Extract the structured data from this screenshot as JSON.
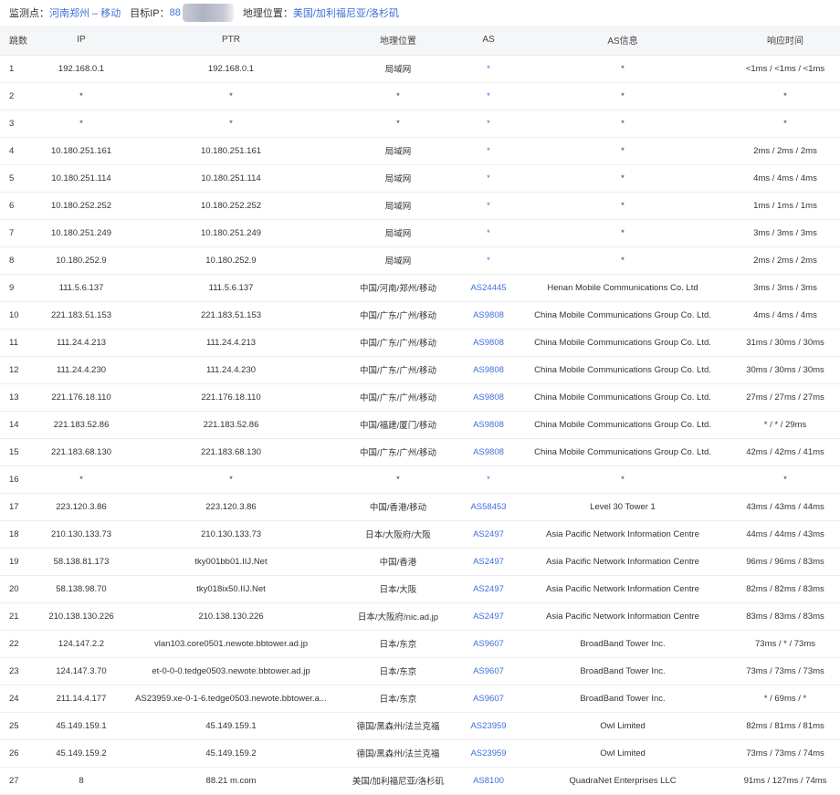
{
  "header": {
    "probe_label": "监测点：",
    "probe_value": "河南郑州 – 移动",
    "target_label": "目标IP：",
    "target_value": "88",
    "geo_label": "地理位置：",
    "geo_value": "美国/加利福尼亚/洛杉矶"
  },
  "table": {
    "columns": [
      "跳数",
      "IP",
      "PTR",
      "地理位置",
      "AS",
      "AS信息",
      "响应时间"
    ],
    "rows": [
      {
        "hop": "1",
        "ip": "192.168.0.1",
        "ptr": "192.168.0.1",
        "geo": "局域网",
        "as": "*",
        "asinfo": "*",
        "rtt": "<1ms / <1ms / <1ms"
      },
      {
        "hop": "2",
        "ip": "*",
        "ptr": "*",
        "geo": "*",
        "as": "*",
        "asinfo": "*",
        "rtt": "*"
      },
      {
        "hop": "3",
        "ip": "*",
        "ptr": "*",
        "geo": "*",
        "as": "*",
        "asinfo": "*",
        "rtt": "*"
      },
      {
        "hop": "4",
        "ip": "10.180.251.161",
        "ptr": "10.180.251.161",
        "geo": "局域网",
        "as": "*",
        "asinfo": "*",
        "rtt": "2ms / 2ms / 2ms"
      },
      {
        "hop": "5",
        "ip": "10.180.251.114",
        "ptr": "10.180.251.114",
        "geo": "局域网",
        "as": "*",
        "asinfo": "*",
        "rtt": "4ms / 4ms / 4ms"
      },
      {
        "hop": "6",
        "ip": "10.180.252.252",
        "ptr": "10.180.252.252",
        "geo": "局域网",
        "as": "*",
        "asinfo": "*",
        "rtt": "1ms / 1ms / 1ms"
      },
      {
        "hop": "7",
        "ip": "10.180.251.249",
        "ptr": "10.180.251.249",
        "geo": "局域网",
        "as": "*",
        "asinfo": "*",
        "rtt": "3ms / 3ms / 3ms"
      },
      {
        "hop": "8",
        "ip": "10.180.252.9",
        "ptr": "10.180.252.9",
        "geo": "局域网",
        "as": "*",
        "asinfo": "*",
        "rtt": "2ms / 2ms / 2ms"
      },
      {
        "hop": "9",
        "ip": "111.5.6.137",
        "ptr": "111.5.6.137",
        "geo": "中国/河南/郑州/移动",
        "as": "AS24445",
        "asinfo": "Henan Mobile Communications Co. Ltd",
        "rtt": "3ms / 3ms / 3ms"
      },
      {
        "hop": "10",
        "ip": "221.183.51.153",
        "ptr": "221.183.51.153",
        "geo": "中国/广东/广州/移动",
        "as": "AS9808",
        "asinfo": "China Mobile Communications Group Co. Ltd.",
        "rtt": "4ms / 4ms / 4ms"
      },
      {
        "hop": "11",
        "ip": "111.24.4.213",
        "ptr": "111.24.4.213",
        "geo": "中国/广东/广州/移动",
        "as": "AS9808",
        "asinfo": "China Mobile Communications Group Co. Ltd.",
        "rtt": "31ms / 30ms / 30ms"
      },
      {
        "hop": "12",
        "ip": "111.24.4.230",
        "ptr": "111.24.4.230",
        "geo": "中国/广东/广州/移动",
        "as": "AS9808",
        "asinfo": "China Mobile Communications Group Co. Ltd.",
        "rtt": "30ms / 30ms / 30ms"
      },
      {
        "hop": "13",
        "ip": "221.176.18.110",
        "ptr": "221.176.18.110",
        "geo": "中国/广东/广州/移动",
        "as": "AS9808",
        "asinfo": "China Mobile Communications Group Co. Ltd.",
        "rtt": "27ms / 27ms / 27ms"
      },
      {
        "hop": "14",
        "ip": "221.183.52.86",
        "ptr": "221.183.52.86",
        "geo": "中国/福建/厦门/移动",
        "as": "AS9808",
        "asinfo": "China Mobile Communications Group Co. Ltd.",
        "rtt": "* / * / 29ms"
      },
      {
        "hop": "15",
        "ip": "221.183.68.130",
        "ptr": "221.183.68.130",
        "geo": "中国/广东/广州/移动",
        "as": "AS9808",
        "asinfo": "China Mobile Communications Group Co. Ltd.",
        "rtt": "42ms / 42ms / 41ms"
      },
      {
        "hop": "16",
        "ip": "*",
        "ptr": "*",
        "geo": "*",
        "as": "*",
        "asinfo": "*",
        "rtt": "*"
      },
      {
        "hop": "17",
        "ip": "223.120.3.86",
        "ptr": "223.120.3.86",
        "geo": "中国/香港/移动",
        "as": "AS58453",
        "asinfo": "Level 30 Tower 1",
        "rtt": "43ms / 43ms / 44ms"
      },
      {
        "hop": "18",
        "ip": "210.130.133.73",
        "ptr": "210.130.133.73",
        "geo": "日本/大阪府/大阪",
        "as": "AS2497",
        "asinfo": "Asia Pacific Network Information Centre",
        "rtt": "44ms / 44ms / 43ms"
      },
      {
        "hop": "19",
        "ip": "58.138.81.173",
        "ptr": "tky001bb01.IIJ.Net",
        "geo": "中国/香港",
        "as": "AS2497",
        "asinfo": "Asia Pacific Network Information Centre",
        "rtt": "96ms / 96ms / 83ms"
      },
      {
        "hop": "20",
        "ip": "58.138.98.70",
        "ptr": "tky018ix50.IIJ.Net",
        "geo": "日本/大阪",
        "as": "AS2497",
        "asinfo": "Asia Pacific Network Information Centre",
        "rtt": "82ms / 82ms / 83ms"
      },
      {
        "hop": "21",
        "ip": "210.138.130.226",
        "ptr": "210.138.130.226",
        "geo": "日本/大阪府/nic.ad.jp",
        "as": "AS2497",
        "asinfo": "Asia Pacific Network Information Centre",
        "rtt": "83ms / 83ms / 83ms"
      },
      {
        "hop": "22",
        "ip": "124.147.2.2",
        "ptr": "vlan103.core0501.newote.bbtower.ad.jp",
        "geo": "日本/东京",
        "as": "AS9607",
        "asinfo": "BroadBand Tower Inc.",
        "rtt": "73ms / * / 73ms"
      },
      {
        "hop": "23",
        "ip": "124.147.3.70",
        "ptr": "et-0-0-0.tedge0503.newote.bbtower.ad.jp",
        "geo": "日本/东京",
        "as": "AS9607",
        "asinfo": "BroadBand Tower Inc.",
        "rtt": "73ms / 73ms / 73ms"
      },
      {
        "hop": "24",
        "ip": "211.14.4.177",
        "ptr": "AS23959.xe-0-1-6.tedge0503.newote.bbtower.a...",
        "geo": "日本/东京",
        "as": "AS9607",
        "asinfo": "BroadBand Tower Inc.",
        "rtt": "* / 69ms / *"
      },
      {
        "hop": "25",
        "ip": "45.149.159.1",
        "ptr": "45.149.159.1",
        "geo": "德国/黑森州/法兰克福",
        "as": "AS23959",
        "asinfo": "Owl Limited",
        "rtt": "82ms / 81ms / 81ms"
      },
      {
        "hop": "26",
        "ip": "45.149.159.2",
        "ptr": "45.149.159.2",
        "geo": "德国/黑森州/法兰克福",
        "as": "AS23959",
        "asinfo": "Owl Limited",
        "rtt": "73ms / 73ms / 74ms"
      },
      {
        "hop": "27",
        "ip": "8",
        "ptr": "88.21 m.com",
        "geo": "美国/加利福尼亚/洛杉矶",
        "as": "AS8100",
        "asinfo": "QuadraNet Enterprises LLC",
        "rtt": "91ms / 127ms / 74ms"
      }
    ]
  },
  "colors": {
    "link": "#3f6fd8",
    "header_bg": "#f5f6f8",
    "row_border": "#eceef1"
  }
}
